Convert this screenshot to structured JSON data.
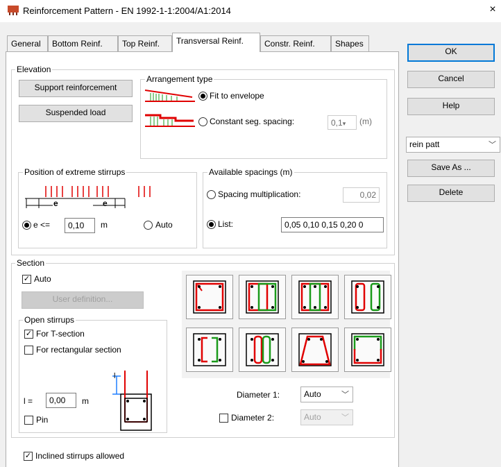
{
  "window": {
    "title": "Reinforcement Pattern - EN 1992-1-1:2004/A1:2014",
    "close_glyph": "×"
  },
  "tabs": [
    {
      "label": "General"
    },
    {
      "label": "Bottom Reinf."
    },
    {
      "label": "Top Reinf."
    },
    {
      "label": "Transversal Reinf."
    },
    {
      "label": "Constr. Reinf."
    },
    {
      "label": "Shapes"
    }
  ],
  "active_tab": "Transversal Reinf.",
  "elevation": {
    "label": "Elevation",
    "support_button": "Support reinforcement",
    "suspended_button": "Suspended load",
    "arrangement": {
      "label": "Arrangement type",
      "fit_label": "Fit to envelope",
      "fit_selected": true,
      "constant_label": "Constant seg. spacing:",
      "constant_value": "0,1",
      "constant_unit": "(m)"
    }
  },
  "extreme_stirrups": {
    "label": "Position of extreme stirrups",
    "e_label": "e <=",
    "e_value": "0,10",
    "unit": "m",
    "auto_label": "Auto",
    "e_selected": true,
    "diagram_letter": "e"
  },
  "available_spacings": {
    "label": "Available spacings (m)",
    "multiplication_label": "Spacing multiplication:",
    "multiplication_value": "0,02",
    "list_label": "List:",
    "list_value": "0,05 0,10 0,15 0,20 0",
    "list_selected": true
  },
  "section": {
    "label": "Section",
    "auto_label": "Auto",
    "auto_checked": true,
    "user_definition_button": "User definition...",
    "open_stirrups": {
      "label": "Open stirrups",
      "t_section_label": "For T-section",
      "t_section_checked": true,
      "rect_label": "For rectangular section",
      "rect_checked": false,
      "l_label": "l =",
      "l_value": "0,00",
      "l_unit": "m",
      "diagram_letter": "l",
      "pin_label": "Pin",
      "pin_checked": false
    },
    "diameter1_label": "Diameter 1:",
    "diameter1_value": "Auto",
    "diameter2_label": "Diameter 2:",
    "diameter2_value": "Auto",
    "diameter2_checked": false
  },
  "inclined_label": "Inclined stirrups allowed",
  "inclined_checked": true,
  "side": {
    "ok": "OK",
    "cancel": "Cancel",
    "help": "Help",
    "pattern_value": "rein patt",
    "save_as": "Save As ...",
    "delete": "Delete"
  },
  "colors": {
    "stirrup_red": "#e00000",
    "stirrup_green": "#1a9a1a",
    "focus_blue": "#0078d7",
    "support_arrow_blue": "#1f7fff"
  },
  "icons": {
    "chevron": "chevron-down-icon",
    "check": "checkmark-icon",
    "app": "reinforcement-app-icon"
  }
}
